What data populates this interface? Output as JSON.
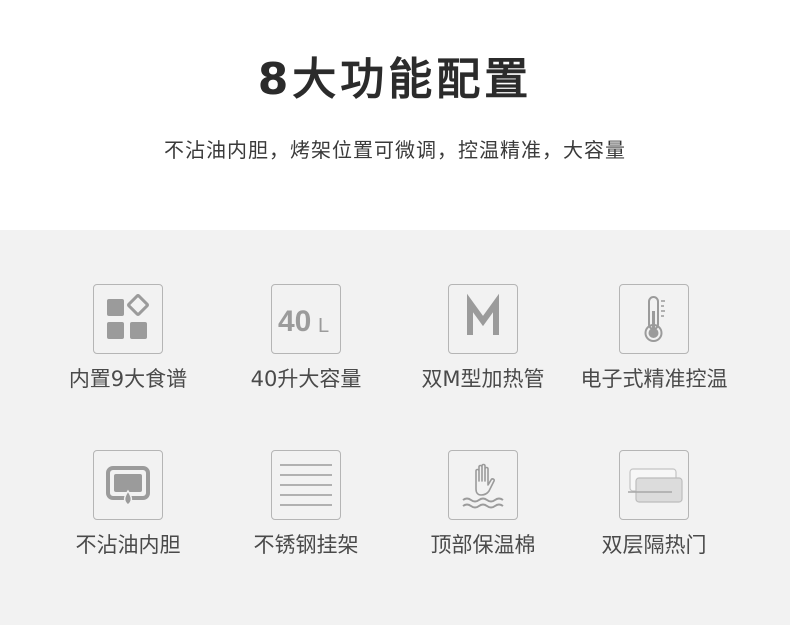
{
  "header": {
    "title": "8大功能配置",
    "subtitle": "不沾油内胆，烤架位置可微调，控温精准，大容量"
  },
  "features": [
    {
      "label": "内置9大食谱",
      "icon": "recipe-grid-icon"
    },
    {
      "label": "40升大容量",
      "icon": "capacity-40l-icon",
      "icon_text": "40",
      "icon_unit": "L"
    },
    {
      "label": "双M型加热管",
      "icon": "m-heating-tube-icon"
    },
    {
      "label": "电子式精准控温",
      "icon": "thermometer-icon"
    },
    {
      "label": "不沾油内胆",
      "icon": "non-stick-liner-icon"
    },
    {
      "label": "不锈钢挂架",
      "icon": "steel-rack-icon"
    },
    {
      "label": "顶部保温棉",
      "icon": "insulation-hand-icon"
    },
    {
      "label": "双层隔热门",
      "icon": "double-door-icon"
    }
  ],
  "colors": {
    "background_top": "#ffffff",
    "background_features": "#f2f2f2",
    "icon_gray": "#9b9b9b",
    "text": "#4a4a4a"
  }
}
